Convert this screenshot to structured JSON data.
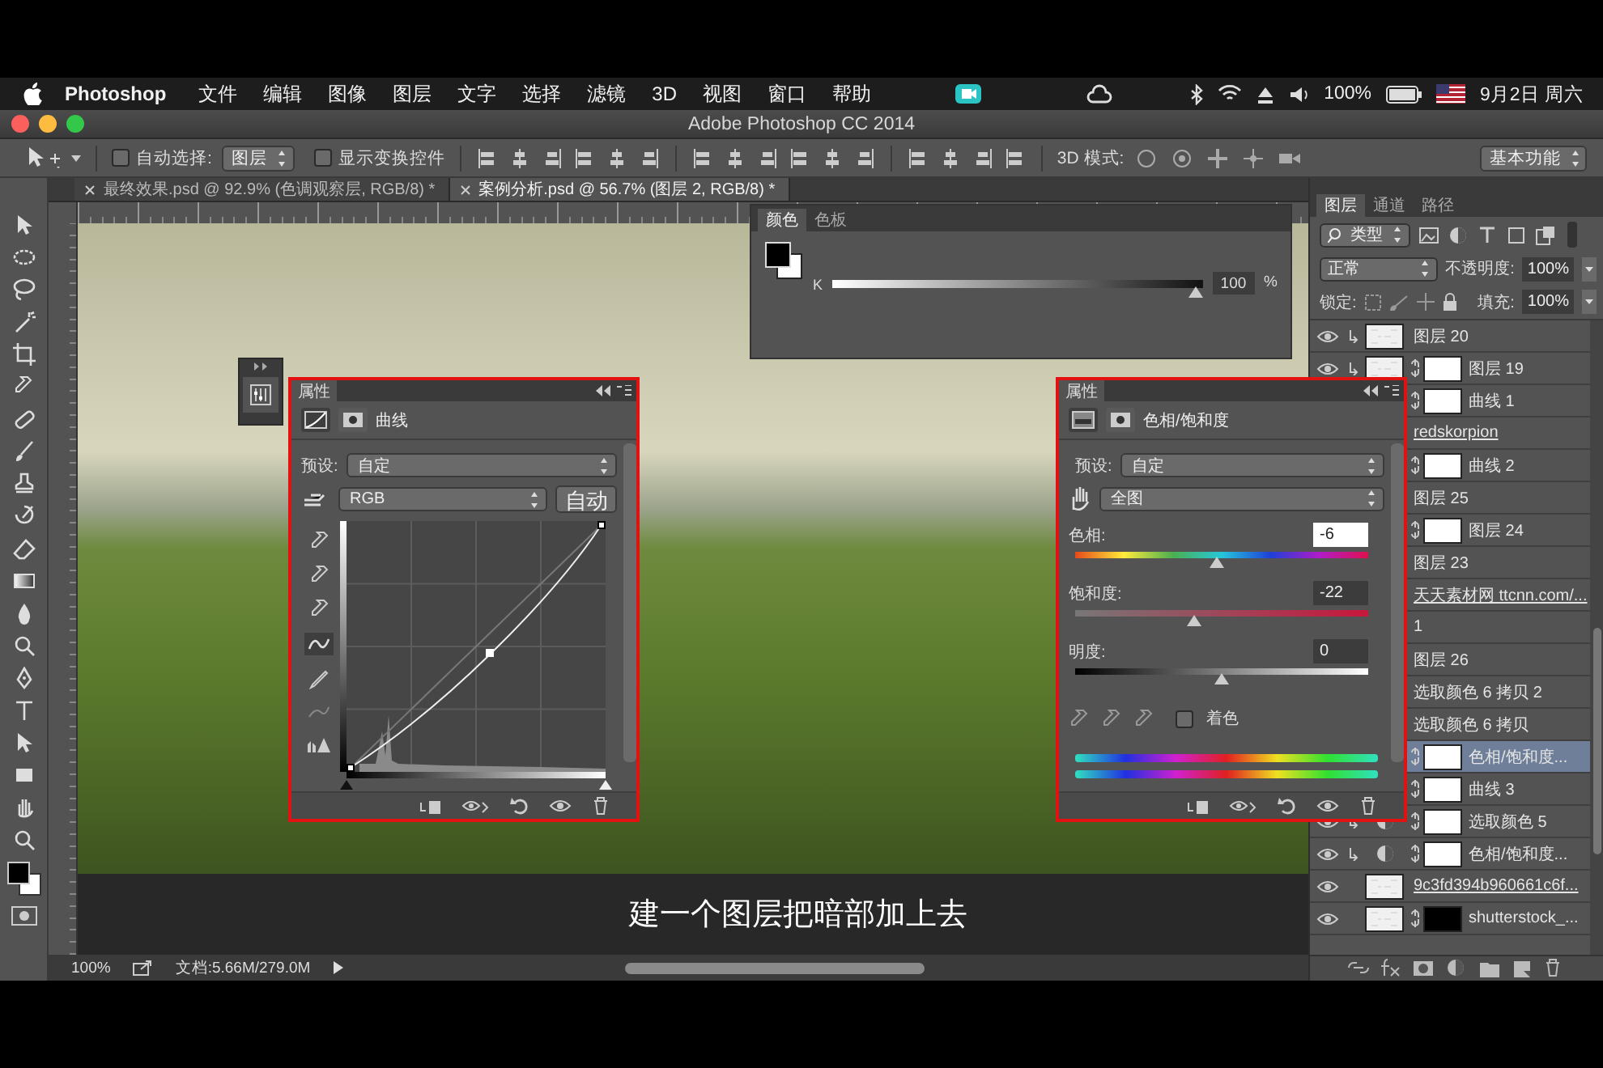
{
  "menubar": {
    "app": "Photoshop",
    "menus": [
      "文件",
      "编辑",
      "图像",
      "图层",
      "文字",
      "选择",
      "滤镜",
      "3D",
      "视图",
      "窗口",
      "帮助"
    ],
    "battery": "100%",
    "clock": "9月2日 周六"
  },
  "window": {
    "title": "Adobe Photoshop CC 2014"
  },
  "options_bar": {
    "auto_select": {
      "label": "自动选择:",
      "checked": false
    },
    "auto_select_target": "图层",
    "show_transform": {
      "label": "显示变换控件",
      "checked": false
    },
    "mode_3d": "3D 模式:",
    "workspace": "基本功能"
  },
  "document_tabs": [
    {
      "label": "最终效果.psd @ 92.9% (色调观察层, RGB/8) *",
      "selected": false
    },
    {
      "label": "案例分析.psd @ 56.7% (图层 2, RGB/8) *",
      "selected": true
    }
  ],
  "color_panel": {
    "tabs": [
      {
        "label": "颜色",
        "selected": true
      },
      {
        "label": "色板",
        "selected": false
      }
    ],
    "channel": "K",
    "level": 1,
    "value": "100",
    "unit": "%"
  },
  "curves_panel": {
    "title": "属性",
    "adjustment": "曲线",
    "preset_label": "预设:",
    "preset": "自定",
    "channel": "RGB",
    "auto_button": "自动"
  },
  "huesat_panel": {
    "title": "属性",
    "adjustment": "色相/饱和度",
    "preset_label": "预设:",
    "preset": "自定",
    "range": "全图",
    "sliders": [
      {
        "kind": "hue",
        "label": "色相:",
        "value": "-6",
        "focused": true,
        "level": 0.48
      },
      {
        "kind": "saturation",
        "label": "饱和度:",
        "value": "-22",
        "focused": false,
        "level": 0.4
      },
      {
        "kind": "lightness",
        "label": "明度:",
        "value": "0",
        "focused": false,
        "level": 0.5
      }
    ],
    "colorize": {
      "label": "着色",
      "checked": false
    }
  },
  "layers_panel": {
    "tabs": [
      {
        "label": "图层",
        "selected": true
      },
      {
        "label": "通道",
        "selected": false
      },
      {
        "label": "路径",
        "selected": false
      }
    ],
    "filter": "类型",
    "blend_mode": "正常",
    "opacity_label": "不透明度:",
    "opacity": "100%",
    "lock_label": "锁定:",
    "fill_label": "填充:",
    "fill": "100%",
    "layers": [
      {
        "name": "图层 20",
        "kind": "pixel",
        "clipped": true,
        "linked": false,
        "selected": false
      },
      {
        "name": "图层 19",
        "kind": "masked",
        "clipped": true,
        "linked": false,
        "selected": false
      },
      {
        "name": "曲线 1",
        "kind": "adjustment",
        "clipped": false,
        "linked": false,
        "selected": false
      },
      {
        "name": "redskorpion",
        "kind": "smart",
        "clipped": false,
        "linked": true,
        "selected": false
      },
      {
        "name": "曲线 2",
        "kind": "adjustment",
        "clipped": false,
        "linked": false,
        "selected": false
      },
      {
        "name": "图层 25",
        "kind": "pixel",
        "clipped": false,
        "linked": false,
        "selected": false
      },
      {
        "name": "图层 24",
        "kind": "masked",
        "clipped": false,
        "linked": false,
        "selected": false
      },
      {
        "name": "图层 23",
        "kind": "pixel",
        "clipped": false,
        "linked": false,
        "selected": false
      },
      {
        "name": "天天素材网 ttcnn.com/...",
        "kind": "plain",
        "clipped": false,
        "linked": true,
        "selected": false
      },
      {
        "name": "1",
        "kind": "plain",
        "clipped": false,
        "linked": false,
        "selected": false
      },
      {
        "name": "图层 26",
        "kind": "plain",
        "clipped": false,
        "linked": false,
        "selected": false
      },
      {
        "name": "选取颜色 6 拷贝 2",
        "kind": "plain",
        "clipped": false,
        "linked": false,
        "selected": false
      },
      {
        "name": "选取颜色 6 拷贝",
        "kind": "plain",
        "clipped": false,
        "linked": false,
        "selected": false
      },
      {
        "name": "色相/饱和度...",
        "kind": "adjustment",
        "clipped": false,
        "linked": false,
        "selected": true
      },
      {
        "name": "曲线 3",
        "kind": "adjustment",
        "clipped": false,
        "linked": false,
        "selected": false
      },
      {
        "name": "选取颜色 5",
        "kind": "adjustment",
        "clipped": true,
        "linked": false,
        "selected": false
      },
      {
        "name": "色相/饱和度...",
        "kind": "adjustment",
        "clipped": true,
        "linked": false,
        "selected": false
      },
      {
        "name": "9c3fd394b960661c6f...",
        "kind": "smart",
        "clipped": false,
        "linked": true,
        "selected": false
      },
      {
        "name": "shutterstock_...",
        "kind": "masked",
        "clipped": false,
        "linked": false,
        "selected": false
      }
    ]
  },
  "subtitle": "建一个图层把暗部加上去",
  "status_bar": {
    "zoom": "100%",
    "doc_info": "文档:5.66M/279.0M"
  }
}
